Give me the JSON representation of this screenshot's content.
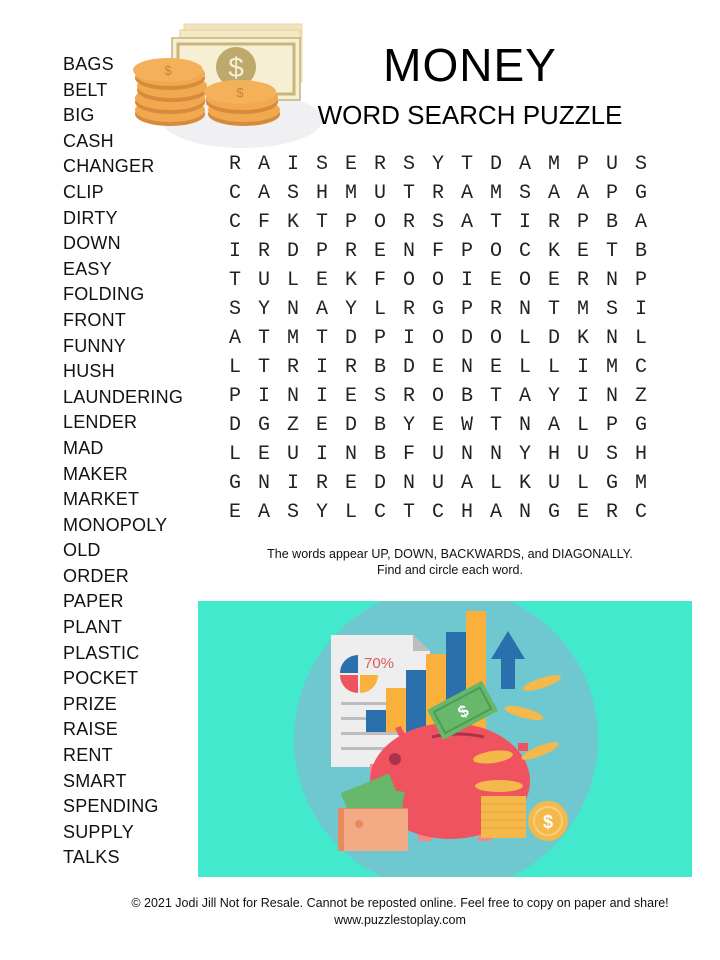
{
  "header": {
    "title": "MONEY",
    "subtitle": "WORD SEARCH PUZZLE"
  },
  "word_list": [
    "BAGS",
    "BELT",
    "BIG",
    "CASH",
    "CHANGER",
    "CLIP",
    "DIRTY",
    "DOWN",
    "EASY",
    "FOLDING",
    "FRONT",
    "FUNNY",
    "HUSH",
    "LAUNDERING",
    "LENDER",
    "MAD",
    "MAKER",
    "MARKET",
    "MONOPOLY",
    "OLD",
    "ORDER",
    "PAPER",
    "PLANT",
    "PLASTIC",
    "POCKET",
    "PRIZE",
    "RAISE",
    "RENT",
    "SMART",
    "SPENDING",
    "SUPPLY",
    "TALKS"
  ],
  "grid": [
    "RAISERSYTDAMPUS",
    "CASHMUTRAMSAAPG",
    "CFKTPORSATIRPBA",
    "IRDPRENFPOCKETB",
    "TULEKFOOIEOERNP",
    "SYNAYLRGPRNTMSI",
    "ATMTDPIODOLDKNL",
    "LTRIRBDENELLIMC",
    "PINIESROBTAYINZ",
    "DGZEDBYEWTNALPG",
    "LEUINBFUNNYHUSH",
    "GNIREDNUALKULGM",
    "EASYLCTCHANGERC"
  ],
  "instructions": {
    "line1": "The words appear UP, DOWN, BACKWARDS, and DIAGONALLY.",
    "line2": "Find and circle each word."
  },
  "illustration": {
    "chart_percent_label": "70%",
    "dollar_sign": "$"
  },
  "header_art": {
    "dollar_sign": "$"
  },
  "footer": {
    "copyright": "© 2021  Jodi Jill Not for Resale. Cannot be reposted online. Feel free to copy on paper and share!",
    "website": "www.puzzlestoplay.com"
  },
  "colors": {
    "illustration_bg": "#43e9cc",
    "circle_bg": "#6fc7d0",
    "coin": "#f5b84a",
    "piggy": "#ef5360",
    "bar_blue": "#2a70ad",
    "bar_orange": "#f9b13b",
    "cash_green": "#67b86a"
  }
}
